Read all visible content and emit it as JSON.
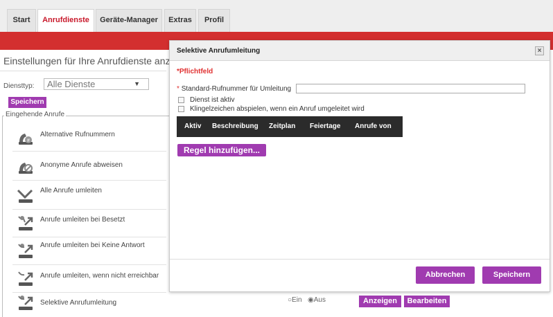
{
  "tabs": [
    {
      "label": "Start",
      "active": false
    },
    {
      "label": "Anrufdienste",
      "active": true
    },
    {
      "label": "Geräte-Manager",
      "active": false
    },
    {
      "label": "Extras",
      "active": false
    },
    {
      "label": "Profil",
      "active": false
    }
  ],
  "page": {
    "title": "Einstellungen für Ihre Anrufdienste anzeig",
    "dienst_label": "Diensttyp:",
    "dienst_value": "Alle Dienste",
    "save_label": "Speichern",
    "legend": "Eingehende Anrufe"
  },
  "services": [
    {
      "label": "Alternative Rufnummern",
      "icon": "alternative-numbers-icon"
    },
    {
      "label": "Anonyme Anrufe abweisen",
      "icon": "reject-anonymous-icon"
    },
    {
      "label": "Alle Anrufe umleiten",
      "icon": "forward-all-icon"
    },
    {
      "label": "Anrufe umleiten bei Besetzt",
      "icon": "forward-busy-icon"
    },
    {
      "label": "Anrufe umleiten bei Keine Antwort",
      "icon": "forward-no-answer-icon"
    },
    {
      "label": "Anrufe umleiten, wenn nicht erreichbar",
      "icon": "forward-unreachable-icon"
    },
    {
      "label": "Selektive Anrufumleitung",
      "icon": "selective-forward-icon"
    }
  ],
  "bottom_row": {
    "radio_on": "Ein",
    "radio_off": "Aus",
    "show_label": "Anzeigen",
    "edit_label": "Bearbeiten"
  },
  "dialog": {
    "title": "Selektive Anrufumleitung",
    "close_label": "×",
    "required_note": "*Pflichtfeld",
    "required_star": "*",
    "std_number_label": "Standard-Rufnummer für Umleitung",
    "std_number_value": "",
    "cb_active_label": "Dienst ist aktiv",
    "cb_ring_label": "Klingelzeichen abspielen, wenn ein Anruf umgeleitet wird",
    "columns": [
      "Aktiv",
      "Beschreibung",
      "Zeitplan",
      "Feiertage",
      "Anrufe von"
    ],
    "add_rule_label": "Regel hinzufügen...",
    "cancel_label": "Abbrechen",
    "save_label": "Speichern"
  },
  "colors": {
    "accent_red": "#d32f2f",
    "button_purple": "#a03bb0",
    "table_header": "#2b2b2b"
  }
}
